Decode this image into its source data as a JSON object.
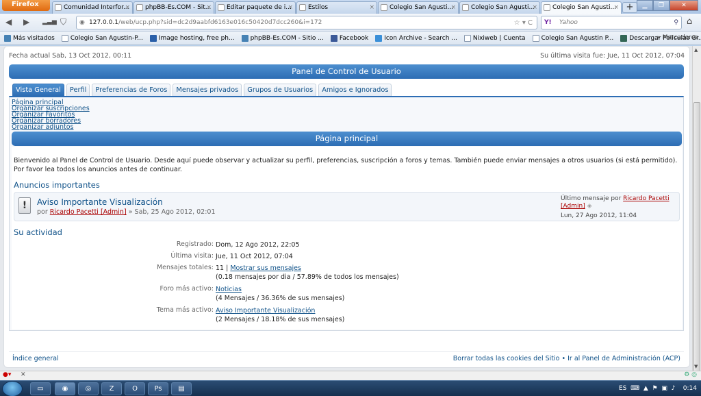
{
  "browser": {
    "menu_label": "Firefox",
    "tabs": [
      {
        "title": "Comunidad Interfor...",
        "active": false
      },
      {
        "title": "phpBB-Es.COM - Sit...",
        "active": false
      },
      {
        "title": "Editar paquete de i...",
        "active": false
      },
      {
        "title": "Estilos",
        "active": false
      },
      {
        "title": "Colegio San Agusti...",
        "active": false
      },
      {
        "title": "Colegio San Agusti...",
        "active": false
      },
      {
        "title": "Colegio San Agusti...",
        "active": true
      }
    ],
    "close_glyph": "×",
    "new_tab_glyph": "+",
    "url_host": "127.0.0.1",
    "url_path": "/web/ucp.php?sid=dc2d9aabfd6163e016c50420d7dcc260&i=172",
    "search_engine": "Yahoo",
    "search_brand": "Y!",
    "bookmarks": [
      {
        "label": "Más visitados",
        "icon": "folder"
      },
      {
        "label": "Colegio San Agustin-P...",
        "icon": "page"
      },
      {
        "label": "Image hosting, free ph...",
        "icon": "image-shack"
      },
      {
        "label": "phpBB-Es.COM - Sitio ...",
        "icon": "phpbb"
      },
      {
        "label": "Facebook",
        "icon": "facebook"
      },
      {
        "label": "Icon Archive - Search ...",
        "icon": "icon-archive"
      },
      {
        "label": "Nixiweb | Cuenta",
        "icon": "page"
      },
      {
        "label": "Colegio San Agustin P...",
        "icon": "page"
      },
      {
        "label": "Descargar Peliculas Gr...",
        "icon": "green"
      }
    ],
    "bookmarks_overflow": "»",
    "bookmarks_menu": "Marcadores"
  },
  "page": {
    "current_date": "Fecha actual Sab, 13 Oct 2012, 00:11",
    "last_visit": "Su última visita fue: Jue, 11 Oct 2012, 07:04",
    "panel_title": "Panel de Control de Usuario",
    "tabs": [
      {
        "label": "Vista General",
        "active": true
      },
      {
        "label": "Perfil",
        "active": false
      },
      {
        "label": "Preferencias de Foros",
        "active": false
      },
      {
        "label": "Mensajes privados",
        "active": false
      },
      {
        "label": "Grupos de Usuarios",
        "active": false
      },
      {
        "label": "Amigos e Ignorados",
        "active": false
      }
    ],
    "side_menu": [
      "Página principal",
      "Organizar suscripciones",
      "Organizar Favoritos",
      "Organizar borradores",
      "Organizar adjuntos"
    ],
    "section_title": "Página principal",
    "welcome": "Bienvenido al Panel de Control de Usuario. Desde aquí puede observar y actualizar su perfil, preferencias, suscripción a foros y temas. También puede enviar mensajes a otros usuarios (si está permitido). Por favor lea todos los anuncios antes de continuar.",
    "announcements_title": "Anuncios importantes",
    "announcement": {
      "title": "Aviso Importante Visualización",
      "by_prefix": "por",
      "author": "Ricardo Pacetti [Admin]",
      "date": "» Sab, 25 Ago 2012, 02:01",
      "last_prefix": "Último mensaje por",
      "last_author_1": "Ricardo Pacetti",
      "last_author_2": "[Admin]",
      "last_date": "Lun, 27 Ago 2012, 11:04"
    },
    "activity_title": "Su actividad",
    "activity": {
      "registered_label": "Registrado:",
      "registered_value": "Dom, 12 Ago 2012, 22:05",
      "lastvisit_label": "Última visita:",
      "lastvisit_value": "Jue, 11 Oct 2012, 07:04",
      "posts_label": "Mensajes totales:",
      "posts_count": "11 |",
      "posts_link": "Mostrar sus mensajes",
      "posts_detail": "(0.18 mensajes por dia / 57.89% de todos los mensajes)",
      "forum_label": "Foro más activo:",
      "forum_link": "Noticias",
      "forum_detail": "(4 Mensajes / 36.36% de sus mensajes)",
      "topic_label": "Tema más activo:",
      "topic_link": "Aviso Importante Visualización",
      "topic_detail": "(2 Mensajes / 18.18% de sus mensajes)"
    },
    "footer_left": "Índice general",
    "footer_right": "Borrar todas las cookies del Sitio • Ir al Panel de Administración (ACP)"
  },
  "taskbar": {
    "language": "ES",
    "time": "0:14"
  }
}
